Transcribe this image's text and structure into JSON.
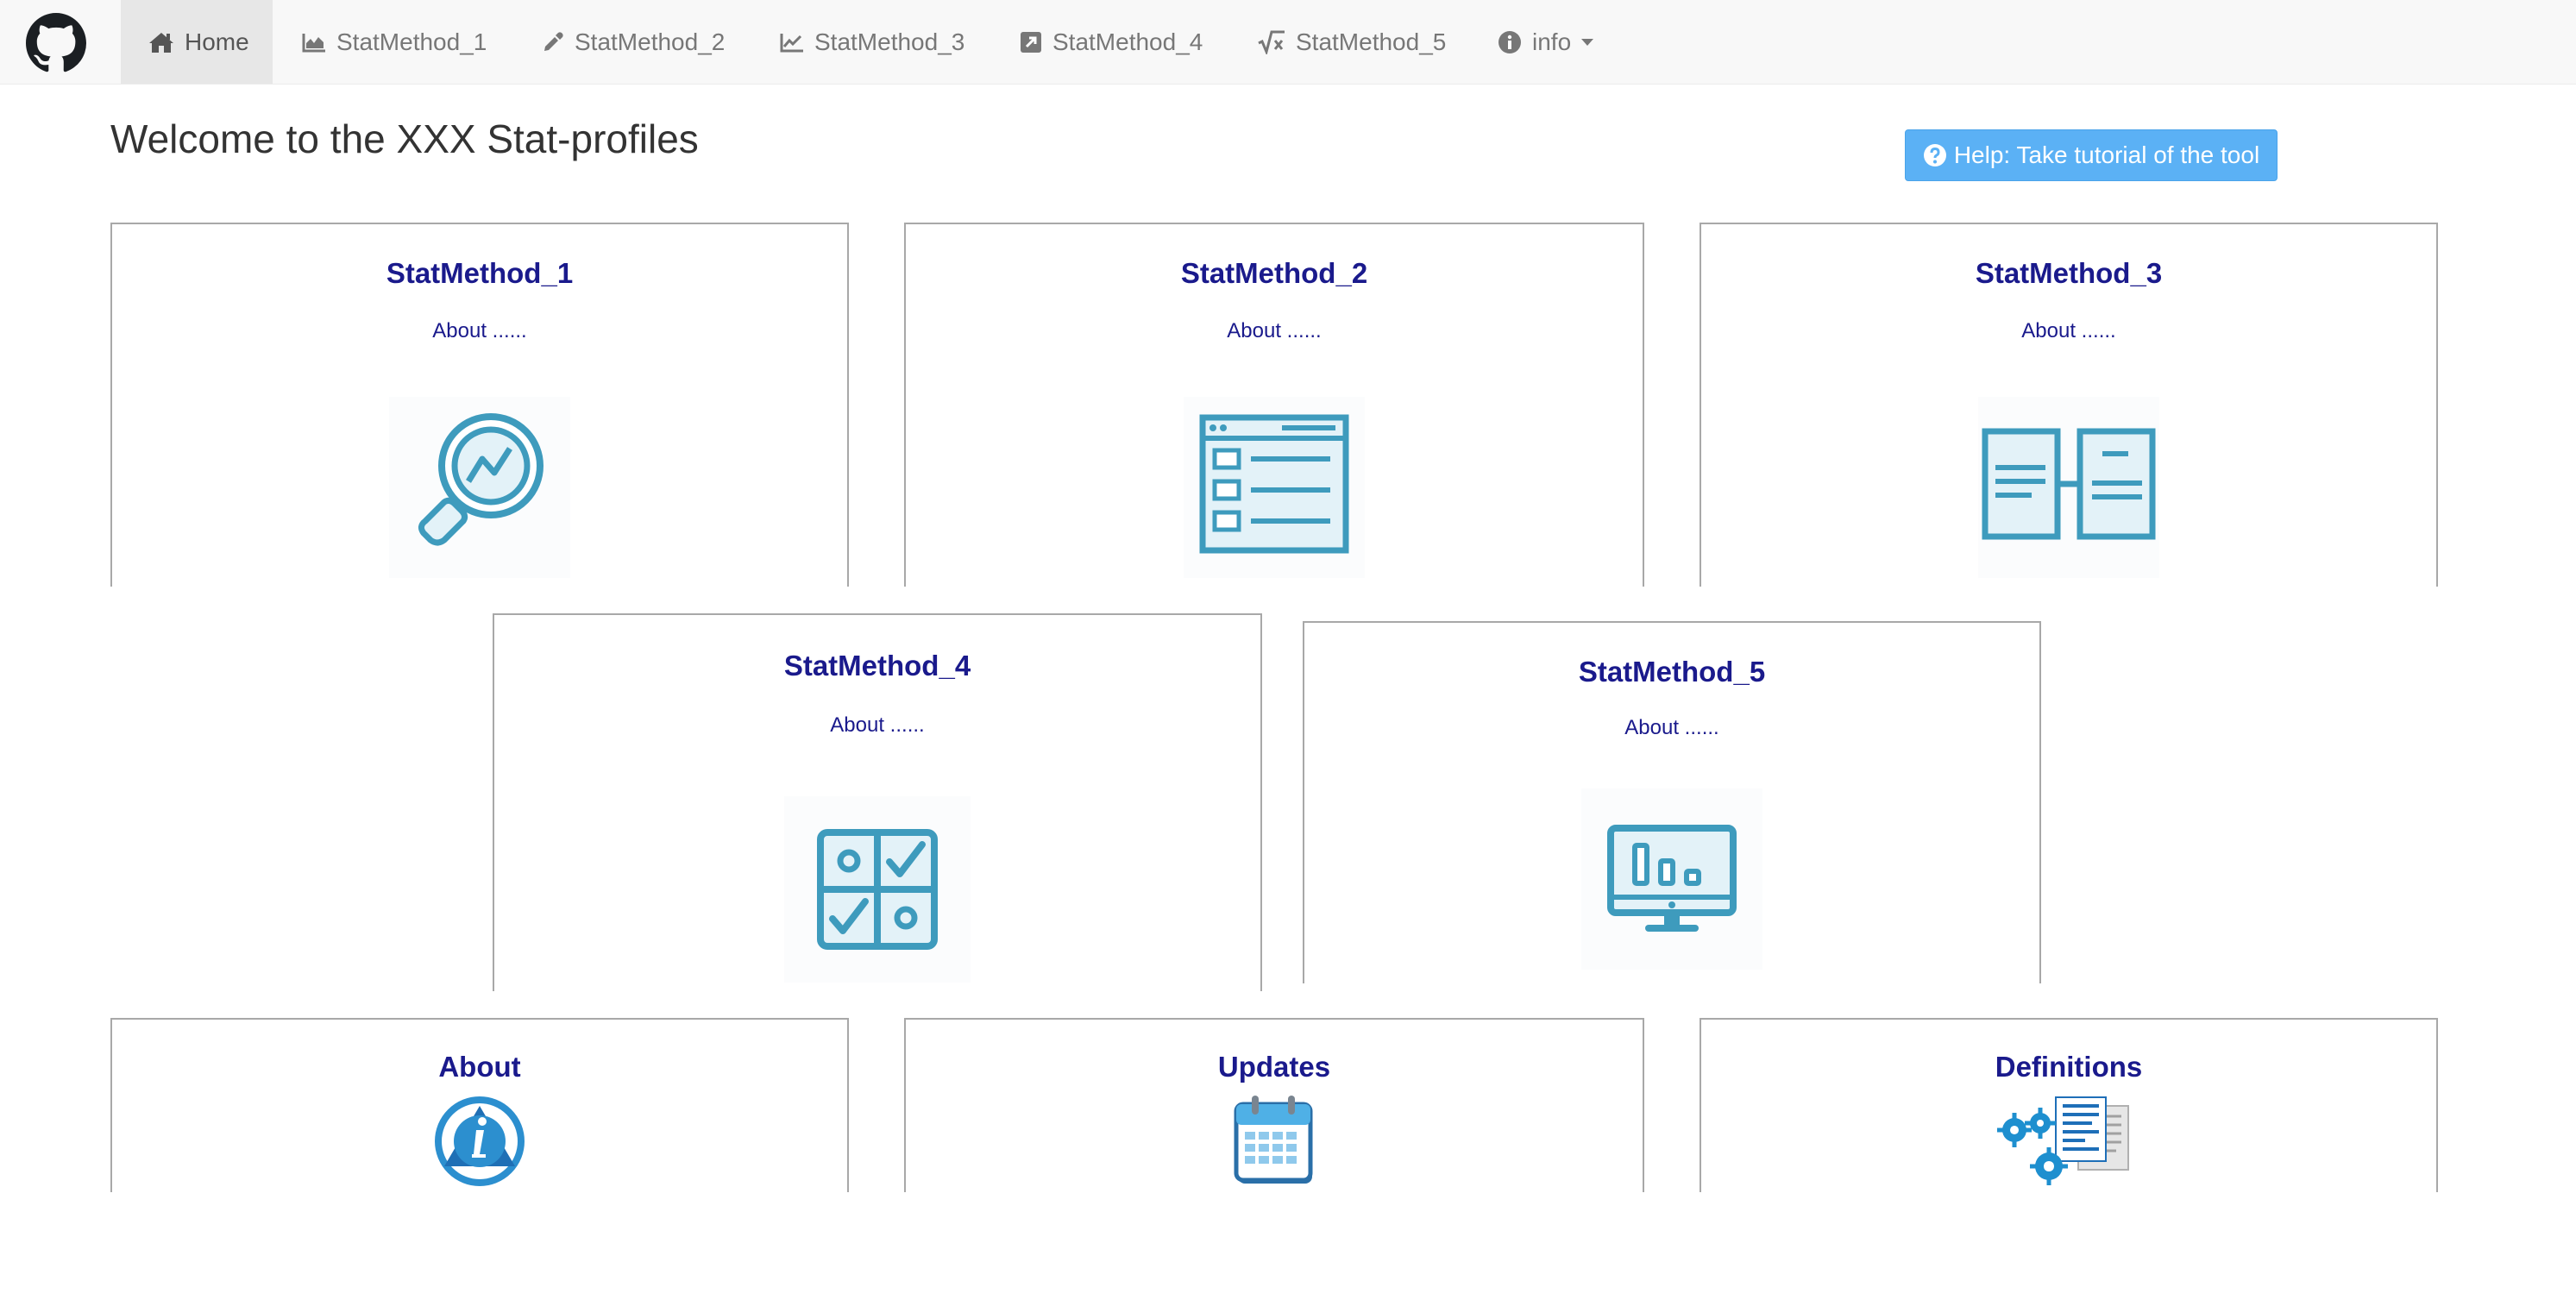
{
  "nav": {
    "tabs": [
      {
        "label": "Home",
        "icon": "home-icon"
      },
      {
        "label": "StatMethod_1",
        "icon": "area-chart-icon"
      },
      {
        "label": "StatMethod_2",
        "icon": "eyedropper-icon"
      },
      {
        "label": "StatMethod_3",
        "icon": "line-chart-icon"
      },
      {
        "label": "StatMethod_4",
        "icon": "external-link-square-icon"
      },
      {
        "label": "StatMethod_5",
        "icon": "square-root-icon"
      },
      {
        "label": "info",
        "icon": "info-circle-icon"
      }
    ],
    "logo": "github-icon",
    "active_tab": "Home"
  },
  "page": {
    "title": "Welcome to the XXX Stat-profiles",
    "help_button": "Help: Take tutorial of the tool"
  },
  "cards": [
    {
      "title": "StatMethod_1",
      "desc": "About ......",
      "icon": "magnifier-trend-icon"
    },
    {
      "title": "StatMethod_2",
      "desc": "About ......",
      "icon": "browser-list-icon"
    },
    {
      "title": "StatMethod_3",
      "desc": "About ......",
      "icon": "book-columns-icon"
    },
    {
      "title": "StatMethod_4",
      "desc": "About ......",
      "icon": "checklist-grid-icon"
    },
    {
      "title": "StatMethod_5",
      "desc": "About ......",
      "icon": "monitor-chart-icon"
    }
  ],
  "info_cards": [
    {
      "title": "About",
      "icon": "info-triangle-icon"
    },
    {
      "title": "Updates",
      "icon": "calendar-icon"
    },
    {
      "title": "Definitions",
      "icon": "gears-document-icon"
    }
  ],
  "colors": {
    "navbar_bg": "#f8f8f8",
    "active_tab_bg": "#e7e7e7",
    "card_title": "#1a1a8c",
    "icon_teal": "#3e9bbd",
    "help_button_bg": "#5bb1f5"
  }
}
